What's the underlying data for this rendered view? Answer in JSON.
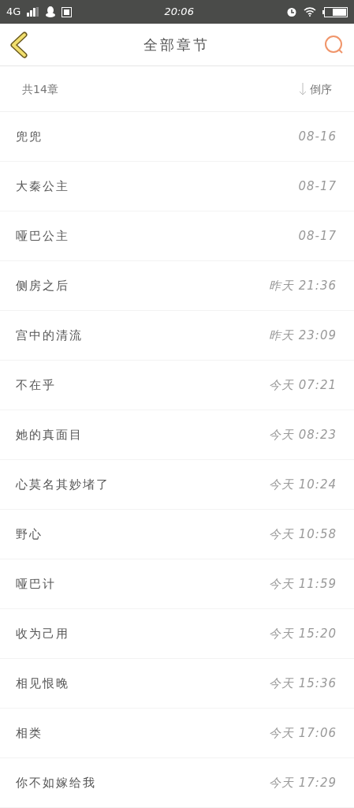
{
  "status_bar": {
    "network": "4G",
    "time": "20:06"
  },
  "header": {
    "title": "全部章节"
  },
  "summary": {
    "count": "共14章",
    "sort": "倒序"
  },
  "chapters": [
    {
      "title": "兜兜",
      "time": "08-16"
    },
    {
      "title": "大秦公主",
      "time": "08-17"
    },
    {
      "title": "哑巴公主",
      "time": "08-17"
    },
    {
      "title": "侧房之后",
      "time": "昨天 21:36"
    },
    {
      "title": "宫中的清流",
      "time": "昨天 23:09"
    },
    {
      "title": "不在乎",
      "time": "今天 07:21"
    },
    {
      "title": "她的真面目",
      "time": "今天 08:23"
    },
    {
      "title": "心莫名其妙堵了",
      "time": "今天 10:24"
    },
    {
      "title": "野心",
      "time": "今天 10:58"
    },
    {
      "title": "哑巴计",
      "time": "今天 11:59"
    },
    {
      "title": "收为己用",
      "time": "今天 15:20"
    },
    {
      "title": "相见恨晚",
      "time": "今天 15:36"
    },
    {
      "title": "相类",
      "time": "今天 17:06"
    },
    {
      "title": "你不如嫁给我",
      "time": "今天 17:29"
    }
  ]
}
